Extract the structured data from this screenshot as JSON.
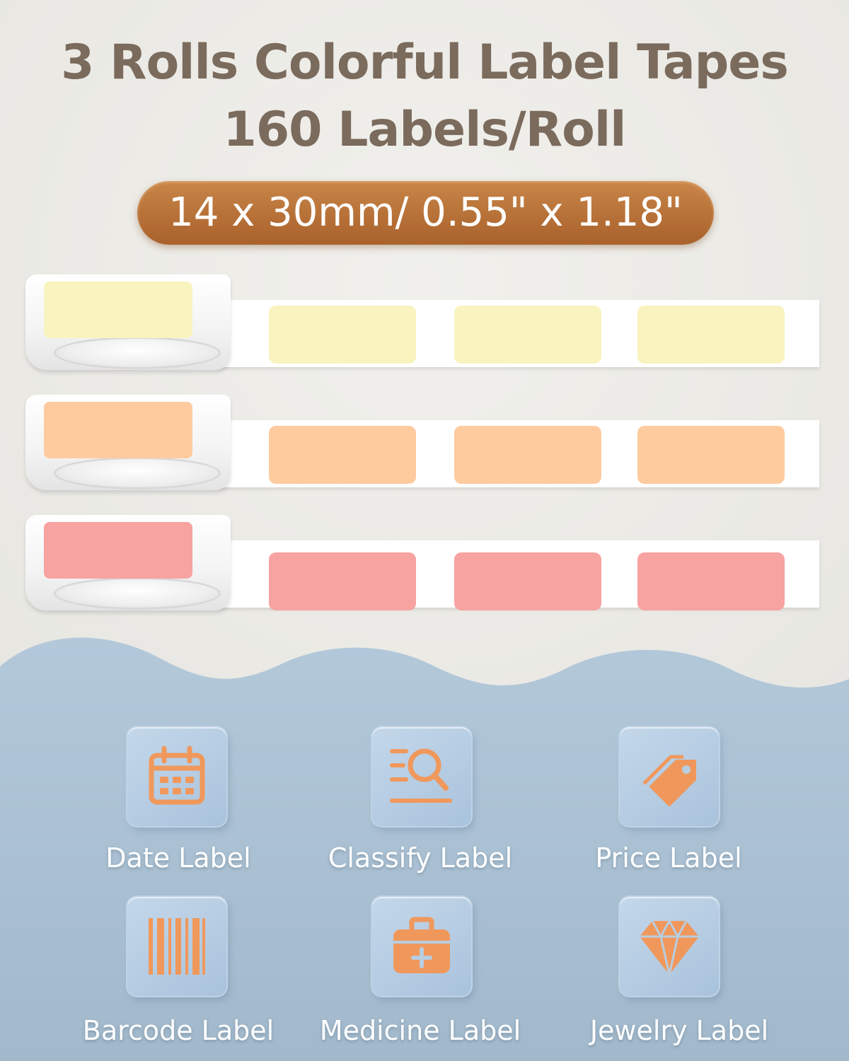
{
  "header": {
    "title_line_1": "3 Rolls Colorful Label Tapes",
    "title_line_2": "160 Labels/Roll",
    "size_text": "14 x 30mm/ 0.55\" x 1.18\""
  },
  "rolls": [
    {
      "color_name": "yellow",
      "color": "#f9f3c0"
    },
    {
      "color_name": "orange",
      "color": "#fecb9f"
    },
    {
      "color_name": "pink",
      "color": "#f7a3a1"
    }
  ],
  "colors": {
    "title": "#7b6b5d",
    "pill": "#b8703a",
    "bottom_bg": "#a9bfd1",
    "icon": "#f0985c"
  },
  "uses": [
    {
      "label": "Date Label",
      "icon": "calendar-icon"
    },
    {
      "label": "Classify Label",
      "icon": "classify-search-icon"
    },
    {
      "label": "Price Label",
      "icon": "price-tag-icon"
    },
    {
      "label": "Barcode Label",
      "icon": "barcode-icon"
    },
    {
      "label": "Medicine Label",
      "icon": "medicine-kit-icon"
    },
    {
      "label": "Jewelry Label",
      "icon": "diamond-icon"
    }
  ]
}
